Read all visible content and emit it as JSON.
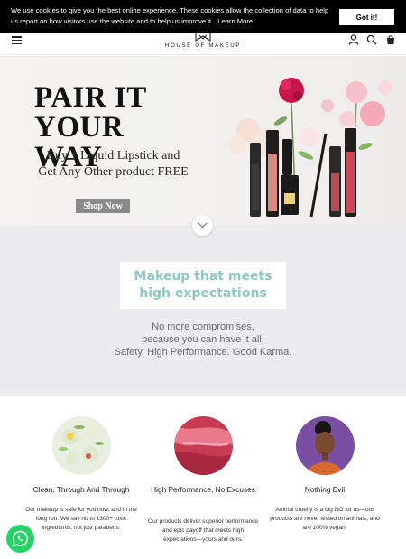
{
  "cookie": {
    "message": "We use cookies to give you the best online experience. These cookies allow the collection of data to help us report on how visitors use the website and to help us improve it.",
    "learn_more": "Learn More",
    "accept": "Got it!"
  },
  "header": {
    "logo_text": "HOUSE OF MAKEUP",
    "icons": [
      "menu-icon",
      "account-icon",
      "search-icon",
      "cart-icon"
    ]
  },
  "hero": {
    "title_line1": "PAIR IT",
    "title_line2": "YOUR WAY",
    "subtitle_line1": "Buy 1 Liquid Lipstick and",
    "subtitle_line2": "Get Any Other product FREE",
    "cta": "Shop Now"
  },
  "intro": {
    "heading_line1": "Makeup that meets",
    "heading_line2": "high expectations",
    "text_line1": "No more compromises,",
    "text_line2": "because you can have it all:",
    "text_line3": "Safety. High Performance. Good Karma."
  },
  "features": [
    {
      "title": "Clean, Through And Through",
      "text": "Our makeup is safe for you now, and in the long run. We say no to 1300+ toxic ingredients, not just parabens."
    },
    {
      "title": "High Performance, No Excuses",
      "text": "Our products deliver superior performance and epic payoff that meets high expectations—yours and ours."
    },
    {
      "title": "Nothing Evil",
      "text": "Animal cruelty is a big NO for us—our products are never tested on animals, and are 100% vegan."
    }
  ],
  "colors": {
    "accent_teal": "#8ccabf",
    "whatsapp": "#25d366",
    "cookie_bg": "#000000"
  }
}
